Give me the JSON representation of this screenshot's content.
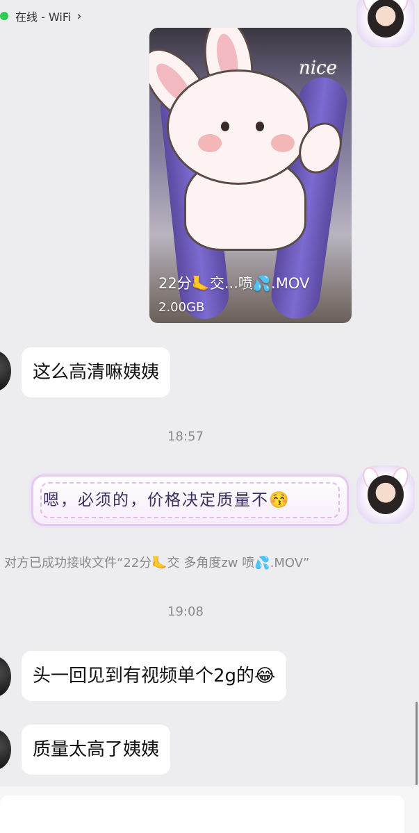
{
  "header": {
    "title": "",
    "status": "在线 - WiFi"
  },
  "video_message": {
    "filename": "22分🦶交...喷💦.MOV",
    "size": "2.00GB",
    "sticker_text": "nice"
  },
  "messages": [
    {
      "id": "m1",
      "text": "这么高清嘛姨姨"
    },
    {
      "id": "t1",
      "time": "18:57"
    },
    {
      "id": "m2",
      "text": "嗯，必须的，价格决定质量不😚"
    },
    {
      "id": "n1",
      "system": "对方已成功接收文件“22分🦶交 多角度zw 喷💦.MOV”"
    },
    {
      "id": "t2",
      "time": "19:08"
    },
    {
      "id": "m3",
      "text": "头一回见到有视频单个2g的😂"
    },
    {
      "id": "m4",
      "text": "质量太高了姨姨"
    }
  ],
  "colors": {
    "background": "#ededf0",
    "online_dot": "#2ecc52",
    "bubble_in": "#ffffff",
    "bubble_out_border": "#e6c9f1"
  },
  "icons": {
    "menu": "menu-icon",
    "status_chevron": "chevron-right-icon"
  }
}
